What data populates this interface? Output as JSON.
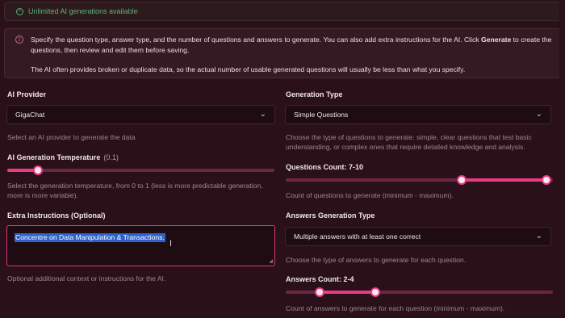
{
  "banner_success": {
    "text": "Unlimited AI generations available"
  },
  "banner_info": {
    "p1_before": "Specify the question type, answer type, and the number of questions and answers to generate. You can also add extra instructions for the AI. Click ",
    "p1_bold": "Generate",
    "p1_after": " to create the questions, then review and edit them before saving.",
    "p2": "The AI often provides broken or duplicate data, so the actual number of usable generated questions will usually be less than what you specify."
  },
  "ai_provider": {
    "label": "AI Provider",
    "value": "GigaChat",
    "help": "Select an AI provider to generate the data"
  },
  "temperature": {
    "label": "AI Generation Temperature",
    "value_text": "(0.1)",
    "value": 0.1,
    "help": "Select the generation temperature, from 0 to 1 (less is more predictable generation, more is more variable)."
  },
  "extra_instructions": {
    "label": "Extra Instructions (Optional)",
    "value": "Concentre on Data Manipulation & Transactions.",
    "help": "Optional additional context or instructions for the AI."
  },
  "generation_type": {
    "label": "Generation Type",
    "value": "Simple Questions",
    "help": "Choose the type of questions to generate: simple, clear questions that test basic understanding, or complex ones that require detailed knowledge and analysis."
  },
  "questions_count": {
    "label": "Questions Count: 7-10",
    "min": 7,
    "max": 10,
    "help": "Count of questions to generate (minimum - maximum)."
  },
  "answers_generation_type": {
    "label": "Answers Generation Type",
    "value": "Multiple answers with at least one correct",
    "help": "Choose the type of answers to generate for each question."
  },
  "answers_count": {
    "label": "Answers Count: 2-4",
    "min": 2,
    "max": 4,
    "help": "Count of answers to generate for each question (minimum - maximum)."
  },
  "colors": {
    "background": "#2a1019",
    "accent": "#ea3b86",
    "success": "#5db37a"
  }
}
